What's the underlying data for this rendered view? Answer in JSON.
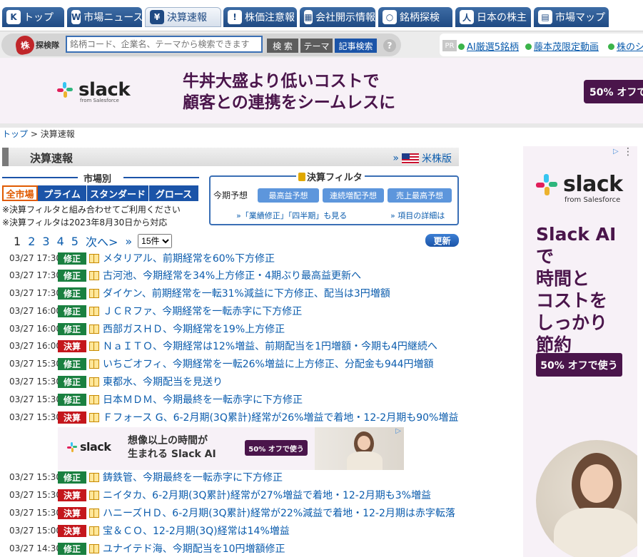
{
  "nav": {
    "tabs": [
      {
        "label": "トップ",
        "icon": "kabutan-icon"
      },
      {
        "label": "市場ニュース",
        "icon": "news-icon"
      },
      {
        "label": "決算速報",
        "icon": "yen-icon"
      },
      {
        "label": "株価注意報",
        "icon": "warning-icon"
      },
      {
        "label": "会社開示情報",
        "icon": "table-icon"
      },
      {
        "label": "銘柄探検",
        "icon": "search-icon"
      },
      {
        "label": "日本の株主",
        "icon": "person-icon"
      },
      {
        "label": "市場マップ",
        "icon": "map-icon"
      }
    ],
    "active_index": 2
  },
  "search": {
    "logo_char": "株",
    "logo_text": "探検隊",
    "placeholder": "銘柄コード、企業名、テーマから検索できます",
    "search_label": "検 索",
    "theme_label": "テーマ",
    "article_label": "記事検索",
    "help": "?"
  },
  "pr": {
    "tag": "PR",
    "links": [
      "AI厳選5銘柄",
      "藤本茂限定動画",
      "株のシ"
    ]
  },
  "banner": {
    "brand": "slack",
    "sub": "from Salesforce",
    "line1": "牛丼大盛より低いコストで",
    "line2": "顧客との連携をシームレスに",
    "cta": "50% オフで"
  },
  "breadcrumb": {
    "home": "トップ",
    "sep": ">",
    "current": "決算速報"
  },
  "section": {
    "title": "決算速報",
    "us_prefix": "»",
    "us_label": "米株版"
  },
  "market": {
    "title": "市場別",
    "tabs": [
      "全市場",
      "プライム",
      "スタンダード",
      "グロース"
    ],
    "selected": 0,
    "note1": "※決算フィルタと組み合わせてご利用ください",
    "note2": "※決算フィルタは2023年8月30日から対応"
  },
  "filter": {
    "title": "決算フィルタ",
    "label": "今期予想",
    "buttons": [
      "最高益予想",
      "連続増配予想",
      "売上最高予想"
    ],
    "link1": "»「業績修正」「四半期」も見る",
    "link2": "» 項目の詳細は"
  },
  "pager": {
    "pages": [
      "1",
      "2",
      "3",
      "4",
      "5"
    ],
    "next": "次へ>",
    "last": "»",
    "per_page": "15件",
    "update": "更新"
  },
  "news": [
    {
      "time": "03/27 17:30",
      "badge": "修正",
      "color": "green",
      "title": "メタリアル、前期経常を60%下方修正"
    },
    {
      "time": "03/27 17:30",
      "badge": "修正",
      "color": "green",
      "title": "古河池、今期経常を34%上方修正・4期ぶり最高益更新へ"
    },
    {
      "time": "03/27 17:30",
      "badge": "修正",
      "color": "green",
      "title": "ダイケン、前期経常を一転31%減益に下方修正、配当は3円増額"
    },
    {
      "time": "03/27 16:00",
      "badge": "修正",
      "color": "green",
      "title": "ＪＣＲファ、今期経常を一転赤字に下方修正"
    },
    {
      "time": "03/27 16:00",
      "badge": "修正",
      "color": "green",
      "title": "西部ガスＨＤ、今期経常を19%上方修正"
    },
    {
      "time": "03/27 16:00",
      "badge": "決算",
      "color": "red",
      "title": "ＮａＩＴＯ、今期経常は12%増益、前期配当を1円増額・今期も4円継続へ"
    },
    {
      "time": "03/27 15:30",
      "badge": "修正",
      "color": "green",
      "title": "いちごオフィ、今期経常を一転26%増益に上方修正、分配金も944円増額"
    },
    {
      "time": "03/27 15:30",
      "badge": "修正",
      "color": "green",
      "title": "東都水、今期配当を見送り"
    },
    {
      "time": "03/27 15:30",
      "badge": "修正",
      "color": "green",
      "title": "日本ＭＤＭ、今期最終を一転赤字に下方修正"
    },
    {
      "time": "03/27 15:30",
      "badge": "決算",
      "color": "red",
      "title": "Ｆフォース G、6-2月期(3Q累計)経常が26%増益で着地・12-2月期も90%増益"
    },
    {
      "time": "03/27 15:30",
      "badge": "修正",
      "color": "green",
      "title": "鋳鉄管、今期最終を一転赤字に下方修正"
    },
    {
      "time": "03/27 15:30",
      "badge": "決算",
      "color": "red",
      "title": "ニイタカ、6-2月期(3Q累計)経常が27%増益で着地・12-2月期も3%増益"
    },
    {
      "time": "03/27 15:30",
      "badge": "決算",
      "color": "red",
      "title": "ハニーズＨＤ、6-2月期(3Q累計)経常が22%減益で着地・12-2月期は赤字転落"
    },
    {
      "time": "03/27 15:00",
      "badge": "決算",
      "color": "red",
      "title": "宝＆ＣＯ、12-2月期(3Q)経常は14%増益"
    },
    {
      "time": "03/27 14:30",
      "badge": "修正",
      "color": "green",
      "title": "ユナイテド海、今期配当を10円増額修正"
    }
  ],
  "inline_ad": {
    "brand": "slack",
    "line1": "想像以上の時間が",
    "line2": "生まれる Slack AI",
    "cta": "50% オフで使う"
  },
  "right_ad": {
    "brand": "slack",
    "sub": "from Salesforce",
    "head": [
      "Slack AI で",
      "時間と",
      "コストを",
      "しっかり",
      "節約"
    ],
    "cta": "50% オフで使う"
  },
  "colors": {
    "nav_blue": "#1f4a83",
    "accent_blue": "#1b54a8",
    "badge_green": "#1a8040",
    "badge_red": "#c4161c",
    "slack_purple": "#4a154b",
    "link": "#0b5cad"
  }
}
